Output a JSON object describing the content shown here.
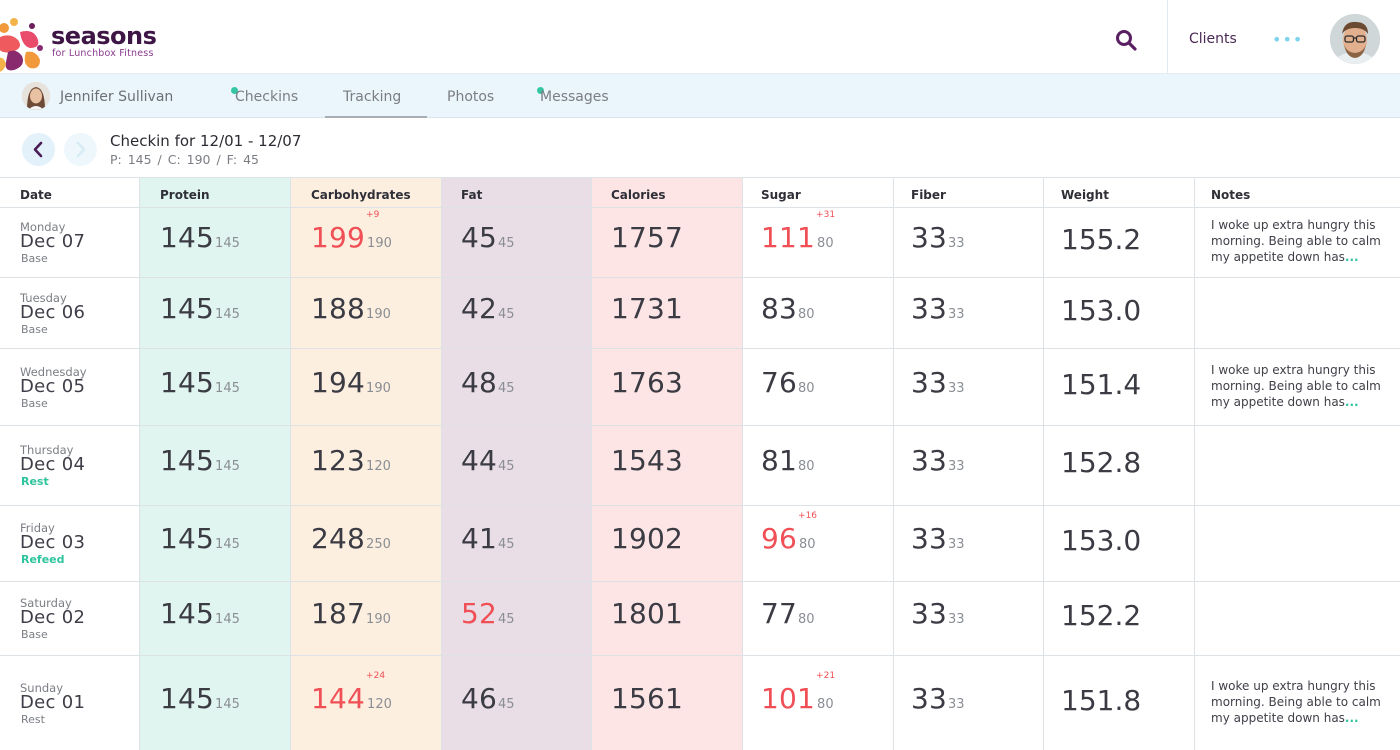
{
  "app": {
    "brand_name": "seasons",
    "brand_tagline": "for Lunchbox Fitness",
    "nav_clients": "Clients",
    "more_label": "•••"
  },
  "subnav": {
    "client_name": "Jennifer Sullivan",
    "tabs": [
      {
        "label": "Checkins",
        "has_dot": true
      },
      {
        "label": "Tracking",
        "active": true
      },
      {
        "label": "Photos"
      },
      {
        "label": "Messages",
        "has_dot": true
      }
    ]
  },
  "checkin": {
    "title": "Checkin for 12/01 - 12/07",
    "macros": "P: 145  /  C:  190  /  F:  45"
  },
  "table": {
    "headers": [
      "Date",
      "Protein",
      "Carbohydrates",
      "Fat",
      "Calories",
      "Sugar",
      "Fiber",
      "Weight",
      "Notes"
    ],
    "column_colors": {
      "protein": "#e1f5f0",
      "carbohydrates": "#fdefe0",
      "fat": "#e9dee6",
      "calories": "#fde5e6"
    },
    "over_color": "#ef4f55",
    "accent_color": "#2fc49e",
    "rows": [
      {
        "dow": "Monday",
        "date": "Dec 07",
        "type": "Base",
        "protein": {
          "value": "145",
          "target": "145"
        },
        "carbs": {
          "value": "199",
          "target": "190",
          "diff": "+9",
          "over": true
        },
        "fat": {
          "value": "45",
          "target": "45"
        },
        "calories": "1757",
        "sugar": {
          "value": "111",
          "target": "80",
          "diff": "+31",
          "over": true
        },
        "fiber": {
          "value": "33",
          "target": "33"
        },
        "weight": "155.2",
        "note": "I woke up extra hungry this morning. Being able to calm my appetite down has",
        "note_more": "..."
      },
      {
        "dow": "Tuesday",
        "date": "Dec 06",
        "type": "Base",
        "protein": {
          "value": "145",
          "target": "145"
        },
        "carbs": {
          "value": "188",
          "target": "190"
        },
        "fat": {
          "value": "42",
          "target": "45"
        },
        "calories": "1731",
        "sugar": {
          "value": "83",
          "target": "80"
        },
        "fiber": {
          "value": "33",
          "target": "33"
        },
        "weight": "153.0",
        "note": "",
        "note_more": ""
      },
      {
        "dow": "Wednesday",
        "date": "Dec 05",
        "type": "Base",
        "protein": {
          "value": "145",
          "target": "145"
        },
        "carbs": {
          "value": "194",
          "target": "190"
        },
        "fat": {
          "value": "48",
          "target": "45"
        },
        "calories": "1763",
        "sugar": {
          "value": "76",
          "target": "80"
        },
        "fiber": {
          "value": "33",
          "target": "33"
        },
        "weight": "151.4",
        "note": "I woke up extra hungry this morning. Being able to calm my appetite down has",
        "note_more": "..."
      },
      {
        "dow": "Thursday",
        "date": "Dec 04",
        "type": "Rest",
        "type_accent": true,
        "protein": {
          "value": "145",
          "target": "145"
        },
        "carbs": {
          "value": "123",
          "target": "120"
        },
        "fat": {
          "value": "44",
          "target": "45"
        },
        "calories": "1543",
        "sugar": {
          "value": "81",
          "target": "80"
        },
        "fiber": {
          "value": "33",
          "target": "33"
        },
        "weight": "152.8",
        "note": "",
        "note_more": ""
      },
      {
        "dow": "Friday",
        "date": "Dec 03",
        "type": "Refeed",
        "type_accent": true,
        "protein": {
          "value": "145",
          "target": "145"
        },
        "carbs": {
          "value": "248",
          "target": "250"
        },
        "fat": {
          "value": "41",
          "target": "45"
        },
        "calories": "1902",
        "sugar": {
          "value": "96",
          "target": "80",
          "diff": "+16",
          "over": true
        },
        "fiber": {
          "value": "33",
          "target": "33"
        },
        "weight": "153.0",
        "note": "",
        "note_more": ""
      },
      {
        "dow": "Saturday",
        "date": "Dec 02",
        "type": "Base",
        "protein": {
          "value": "145",
          "target": "145"
        },
        "carbs": {
          "value": "187",
          "target": "190"
        },
        "fat": {
          "value": "52",
          "target": "45",
          "over": true
        },
        "calories": "1801",
        "sugar": {
          "value": "77",
          "target": "80"
        },
        "fiber": {
          "value": "33",
          "target": "33"
        },
        "weight": "152.2",
        "note": "",
        "note_more": ""
      },
      {
        "dow": "Sunday",
        "date": "Dec 01",
        "type": "Rest",
        "protein": {
          "value": "145",
          "target": "145"
        },
        "carbs": {
          "value": "144",
          "target": "120",
          "diff": "+24",
          "over": true
        },
        "fat": {
          "value": "46",
          "target": "45"
        },
        "calories": "1561",
        "sugar": {
          "value": "101",
          "target": "80",
          "diff": "+21",
          "over": true
        },
        "fiber": {
          "value": "33",
          "target": "33"
        },
        "weight": "151.8",
        "note": "I woke up extra hungry this morning. Being able to calm my appetite down has",
        "note_more": "..."
      }
    ]
  }
}
